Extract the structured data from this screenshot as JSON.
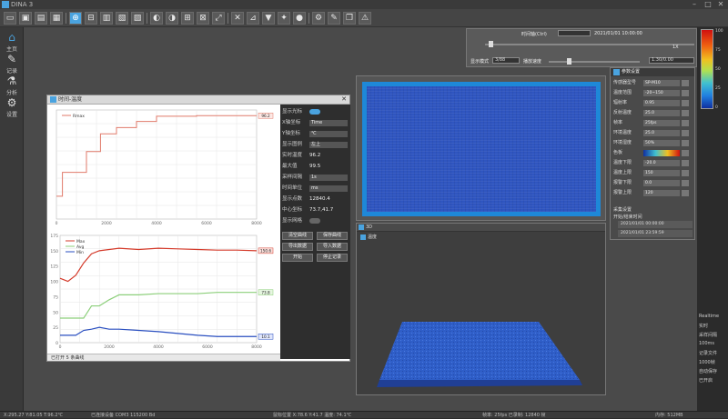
{
  "app": {
    "title": "DINA 3"
  },
  "toolbar": {
    "buttons": [
      "open-icon",
      "save-icon",
      "folder-icon",
      "grid-icon",
      "crosshair-icon",
      "link-icon",
      "layers-icon",
      "chart-icon",
      "cube-icon",
      "rotate-icon",
      "palette-icon",
      "zoom-icon",
      "fit-icon",
      "expand-icon",
      "shuffle-icon",
      "ruler-icon",
      "filter-icon",
      "wand-icon",
      "record-icon",
      "settings-icon",
      "pencil-icon",
      "copy-icon",
      "warning-icon"
    ]
  },
  "nav": {
    "items": [
      {
        "icon": "home-icon",
        "label": "主页"
      },
      {
        "icon": "record-icon",
        "label": "记录"
      },
      {
        "icon": "analysis-icon",
        "label": "分析"
      },
      {
        "icon": "settings-icon",
        "label": "设置"
      }
    ]
  },
  "chart_window": {
    "title": "时间-温度",
    "status": "已打开 5 条曲线",
    "controls": [
      {
        "key": "显示光标",
        "toggle": true
      },
      {
        "key": "X轴坐标",
        "value": "Time"
      },
      {
        "key": "Y轴坐标",
        "value": "℃"
      },
      {
        "key": "显示图例",
        "value": "左上"
      },
      {
        "key": "实时温度",
        "text": "96.2"
      },
      {
        "key": "最大值",
        "text": "99.5"
      },
      {
        "key": "采样间隔",
        "value": "1s"
      },
      {
        "key": "时间单位",
        "value": "ms"
      },
      {
        "key": "显示点数",
        "text": "12840.4"
      },
      {
        "key": "中心坐标",
        "text": "73.7,41.7"
      },
      {
        "key": "显示网格",
        "toggle": false
      }
    ],
    "buttons": [
      "清空曲线",
      "保存曲线",
      "导出数据",
      "导入数据",
      "开始",
      "停止记录"
    ]
  },
  "chart_data": [
    {
      "type": "line",
      "title": "",
      "x": [
        0,
        300,
        300,
        1500,
        1500,
        2200,
        2200,
        3000,
        3000,
        4000,
        4000,
        5000,
        5000,
        7000,
        7000,
        10000
      ],
      "series": [
        {
          "name": "Rmax",
          "values": [
            22,
            22,
            45,
            45,
            65,
            65,
            82,
            82,
            88,
            88,
            94,
            94,
            99,
            99,
            99.5,
            99.5
          ]
        }
      ],
      "xlim": [
        0,
        10000
      ],
      "ticks_x": [
        "0",
        "2000",
        "4000",
        "6000",
        "8000"
      ],
      "end_label": "96.2"
    },
    {
      "type": "line",
      "title": "",
      "x": [
        0,
        400,
        800,
        1200,
        1600,
        2000,
        2500,
        3000,
        4000,
        5000,
        6000,
        7000,
        8000,
        9000,
        10000
      ],
      "series": [
        {
          "name": "Max",
          "values": [
            105,
            100,
            110,
            130,
            145,
            150,
            152,
            154,
            152,
            154,
            153,
            152,
            151,
            151,
            150
          ]
        },
        {
          "name": "Avg",
          "values": [
            40,
            40,
            40,
            40,
            60,
            60,
            70,
            78,
            78,
            80,
            80,
            80,
            82,
            82,
            82
          ]
        },
        {
          "name": "Min",
          "values": [
            12,
            12,
            12,
            20,
            22,
            25,
            22,
            22,
            20,
            18,
            15,
            12,
            10,
            10,
            10
          ]
        }
      ],
      "xlim": [
        0,
        10000
      ],
      "ylim": [
        0,
        175
      ],
      "ticks_y": [
        "0",
        "25",
        "50",
        "75",
        "100",
        "125",
        "150",
        "175"
      ],
      "ticks_x": [
        "0",
        "2000",
        "4000",
        "6000",
        "8000"
      ],
      "end_labels": [
        "150.6",
        "73.8",
        "10.1"
      ]
    }
  ],
  "heat_window": {
    "title": "热成像"
  },
  "view3d": {
    "title": "3D",
    "legend": "温度"
  },
  "top_panel": {
    "name_label": "时间轴(Ctrl)",
    "time_range": "2021/01/01 10:00:00",
    "speed": "1X",
    "frame": "3/88",
    "step_label": "显示模式",
    "speed_label": "播放速度",
    "value": "0.1920.0",
    "end": "1.30/0.00"
  },
  "color_bar": {
    "ticks": [
      "100",
      "",
      "75",
      "",
      "50",
      "",
      "25",
      "",
      "0"
    ]
  },
  "settings_panel": {
    "title": "参数设置",
    "rows": [
      {
        "key": "传感器型号",
        "value": "SP-M10"
      },
      {
        "key": "温度范围",
        "value": "-20~150"
      },
      {
        "key": "辐射率",
        "value": "0.95"
      },
      {
        "key": "反射温度",
        "value": "25.0"
      },
      {
        "key": "帧率",
        "value": "25fps"
      },
      {
        "key": "环境温度",
        "value": "25.0"
      },
      {
        "key": "环境湿度",
        "value": "50%"
      },
      {
        "key": "色板",
        "gradient": true
      },
      {
        "key": "温度下限",
        "value": "-20.0"
      },
      {
        "key": "温度上限",
        "value": "150"
      },
      {
        "key": "报警下限",
        "value": "0.0"
      },
      {
        "key": "报警上限",
        "value": "120"
      }
    ],
    "section": "采集设置",
    "dates": [
      "2021/01/01 00:00:00",
      "2021/01/01 23:59:59"
    ],
    "date_label": "开始/结束时间"
  },
  "bottom_right": [
    "Realtime",
    "实时",
    "采样间隔",
    "100ms",
    "记录文件",
    "1000帧",
    "自动保存",
    "已开启"
  ],
  "statusbar": {
    "left": "X:295.27 Y:81.05 T:96.2℃",
    "mid1": "已连接设备 COM3 115200 Bd",
    "mid2": "鼠标位置 X:78.6 Y:41.7 温度: 74.1℃",
    "right1": "帧率: 25fps 已录制: 12840 帧",
    "right2": "内存: 512MB"
  }
}
